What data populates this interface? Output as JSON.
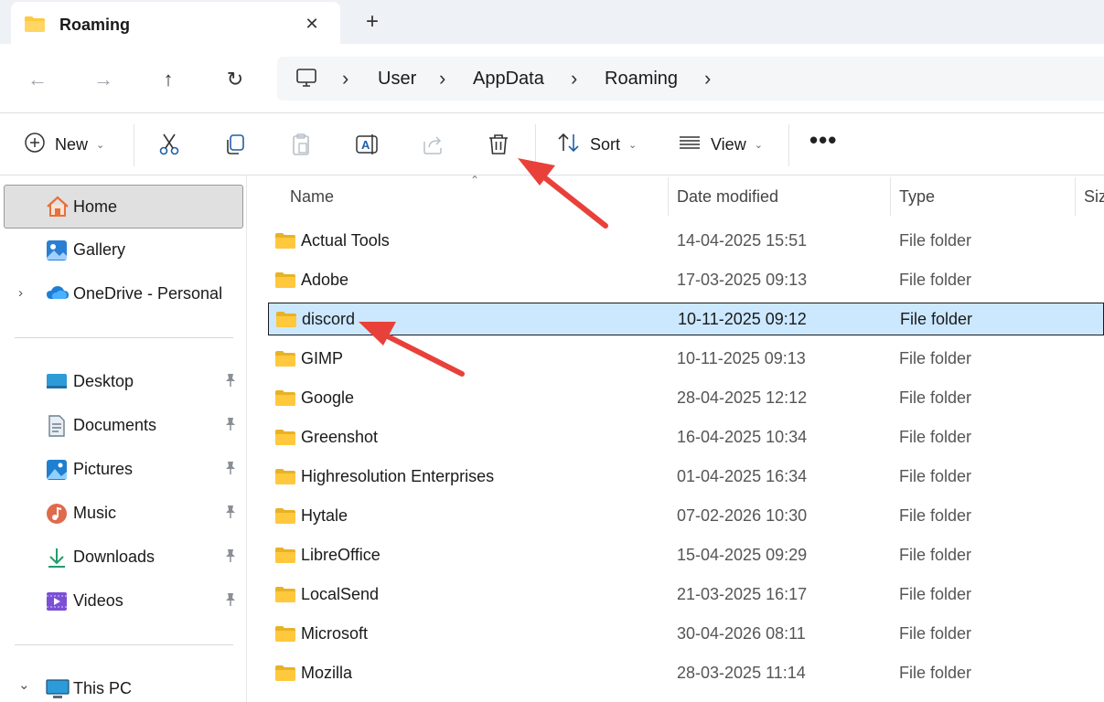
{
  "window": {
    "tab_title": "Roaming",
    "close_glyph": "✕",
    "new_tab_glyph": "+"
  },
  "nav": {
    "back_glyph": "←",
    "forward_glyph": "→",
    "up_glyph": "↑",
    "refresh_glyph": "↻"
  },
  "breadcrumb": [
    "User",
    "AppData",
    "Roaming"
  ],
  "breadcrumb_sep": "›",
  "toolbar": {
    "new_label": "New",
    "sort_label": "Sort",
    "view_label": "View",
    "caret": "⌄",
    "more_glyph": "•••"
  },
  "sidebar": {
    "home": "Home",
    "gallery": "Gallery",
    "onedrive": "OneDrive - Personal",
    "quick_access": [
      {
        "label": "Desktop",
        "icon": "desktop-icon"
      },
      {
        "label": "Documents",
        "icon": "documents-icon"
      },
      {
        "label": "Pictures",
        "icon": "pictures-icon"
      },
      {
        "label": "Music",
        "icon": "music-icon"
      },
      {
        "label": "Downloads",
        "icon": "downloads-icon"
      },
      {
        "label": "Videos",
        "icon": "videos-icon"
      }
    ],
    "this_pc": "This PC",
    "expand_glyph": "›",
    "collapse_glyph": "⌄",
    "pin_glyph": "📌"
  },
  "columns": {
    "name": "Name",
    "date": "Date modified",
    "type": "Type",
    "size": "Siz",
    "sort_glyph": "⌃"
  },
  "files": [
    {
      "name": "Actual Tools",
      "date": "14-04-2025 15:51",
      "type": "File folder"
    },
    {
      "name": "Adobe",
      "date": "17-03-2025 09:13",
      "type": "File folder"
    },
    {
      "name": "discord",
      "date": "10-11-2025 09:12",
      "type": "File folder",
      "selected": true
    },
    {
      "name": "GIMP",
      "date": "10-11-2025 09:13",
      "type": "File folder"
    },
    {
      "name": "Google",
      "date": "28-04-2025 12:12",
      "type": "File folder"
    },
    {
      "name": "Greenshot",
      "date": "16-04-2025 10:34",
      "type": "File folder"
    },
    {
      "name": "Highresolution Enterprises",
      "date": "01-04-2025 16:34",
      "type": "File folder"
    },
    {
      "name": "Hytale",
      "date": "07-02-2026 10:30",
      "type": "File folder"
    },
    {
      "name": "LibreOffice",
      "date": "15-04-2025 09:29",
      "type": "File folder"
    },
    {
      "name": "LocalSend",
      "date": "21-03-2025 16:17",
      "type": "File folder"
    },
    {
      "name": "Microsoft",
      "date": "30-04-2026 08:11",
      "type": "File folder"
    },
    {
      "name": "Mozilla",
      "date": "28-03-2025 11:14",
      "type": "File folder"
    }
  ],
  "colors": {
    "selection": "#cce8ff",
    "folder": "#ffc83d",
    "arrow": "#e8413a",
    "accent": "#0067c0"
  }
}
